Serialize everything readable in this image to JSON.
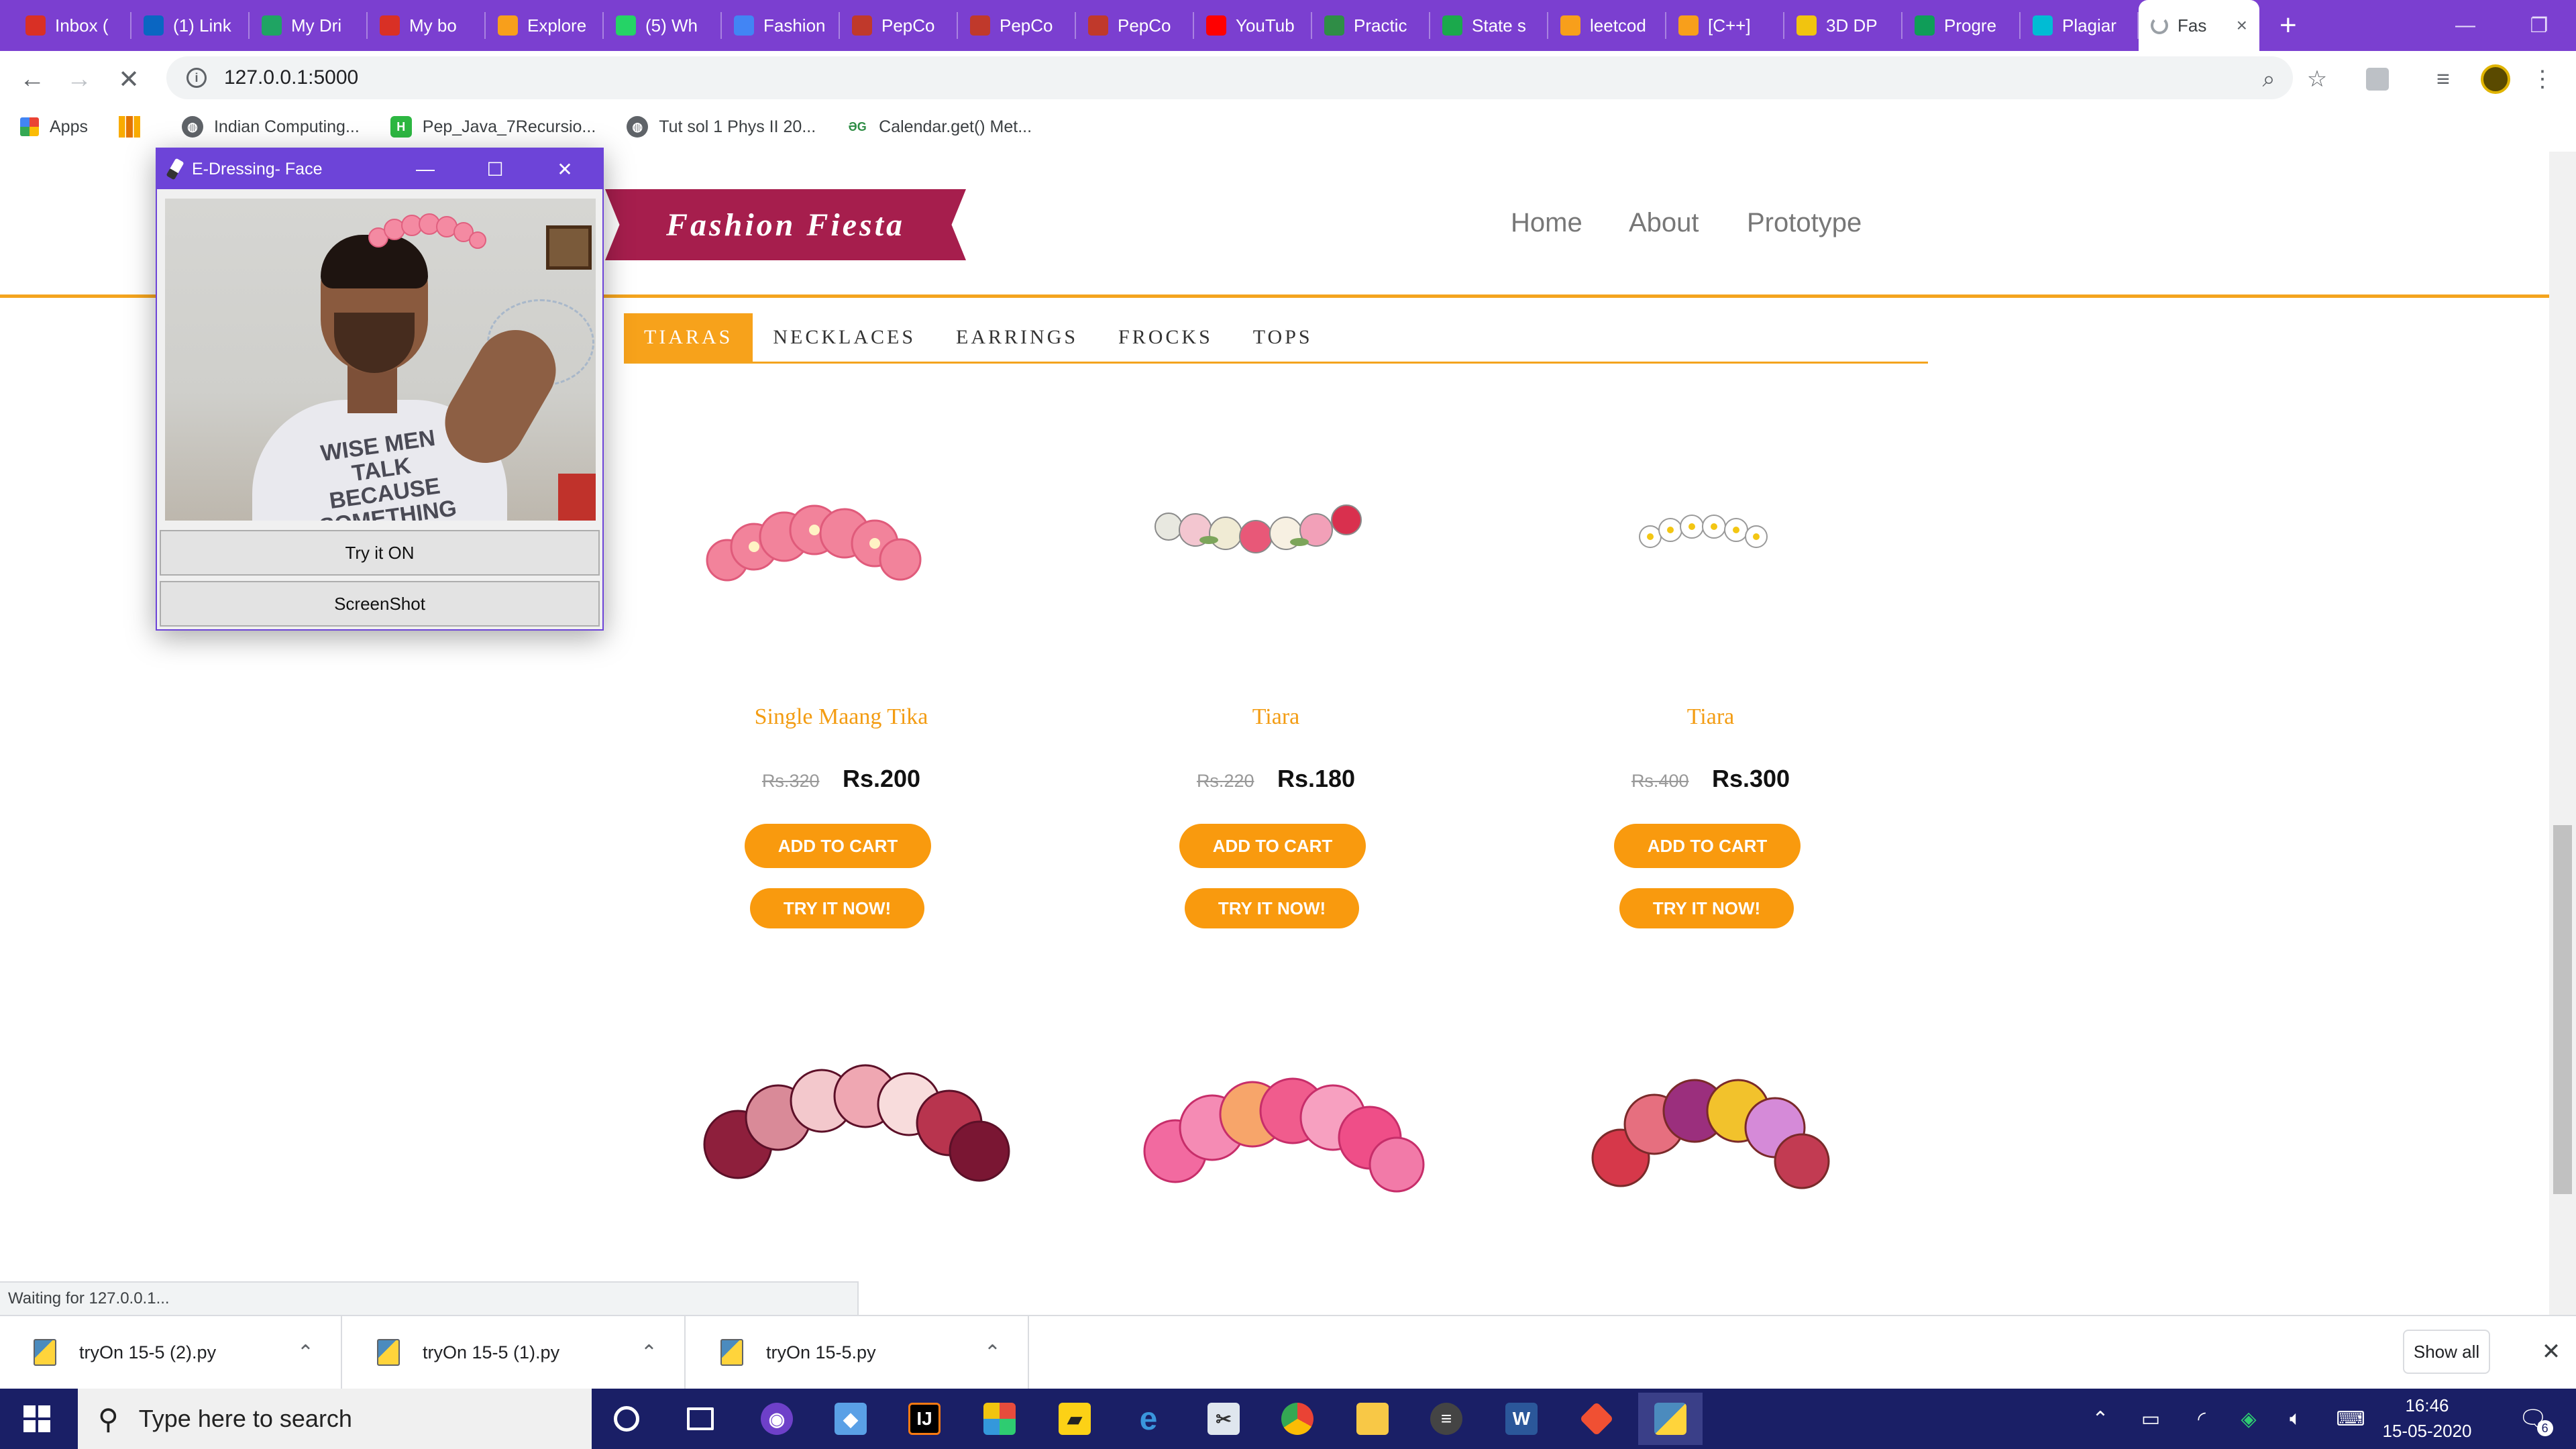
{
  "browser": {
    "tabs": [
      {
        "label": "Inbox (",
        "icon": "gmail-icon",
        "color": "#d93025"
      },
      {
        "label": "(1) Link",
        "icon": "linkedin-icon",
        "color": "#0a66c2"
      },
      {
        "label": "My Dri",
        "icon": "drive-icon",
        "color": "#1fa463"
      },
      {
        "label": "My bo",
        "icon": "gmail-icon",
        "color": "#d93025"
      },
      {
        "label": "Explore",
        "icon": "leetcode-icon",
        "color": "#f89f1b"
      },
      {
        "label": "(5) Wh",
        "icon": "whatsapp-icon",
        "color": "#25d366"
      },
      {
        "label": "Fashion",
        "icon": "docs-icon",
        "color": "#4285f4"
      },
      {
        "label": "PepCo",
        "icon": "pepcoding-icon",
        "color": "#c0392b"
      },
      {
        "label": "PepCo",
        "icon": "pepcoding-icon",
        "color": "#c0392b"
      },
      {
        "label": "PepCo",
        "icon": "pepcoding-icon",
        "color": "#c0392b"
      },
      {
        "label": "YouTub",
        "icon": "youtube-icon",
        "color": "#ff0000"
      },
      {
        "label": "Practic",
        "icon": "gfg-icon",
        "color": "#2f8d46"
      },
      {
        "label": "State s",
        "icon": "hackerrank-icon",
        "color": "#1ba94c"
      },
      {
        "label": "leetcod",
        "icon": "leetcode-icon",
        "color": "#f89f1b"
      },
      {
        "label": "[C++] ",
        "icon": "leetcode-icon",
        "color": "#f89f1b"
      },
      {
        "label": "3D DP",
        "icon": "bulb-icon",
        "color": "#f1c40f"
      },
      {
        "label": "Progre",
        "icon": "classroom-icon",
        "color": "#0f9d58"
      },
      {
        "label": "Plagiar",
        "icon": "plagiarism-icon",
        "color": "#00bcd4"
      }
    ],
    "active_tab": {
      "label": "Fas"
    },
    "url": "127.0.0.1:5000",
    "bookmarks": [
      {
        "label": "Apps"
      },
      {
        "label": ""
      },
      {
        "label": "Indian Computing..."
      },
      {
        "label": "Pep_Java_7Recursio..."
      },
      {
        "label": "Tut sol 1 Phys II 20..."
      },
      {
        "label": "Calendar.get() Met..."
      }
    ],
    "status_text": "Waiting for 127.0.0.1..."
  },
  "site": {
    "brand": "Fashion Fiesta",
    "nav": {
      "home": "Home",
      "about": "About",
      "prototype": "Prototype"
    },
    "categories": [
      "TIARAS",
      "NECKLACES",
      "EARRINGS",
      "FROCKS",
      "TOPS"
    ],
    "active_category": "TIARAS",
    "products": [
      {
        "name": "Single Maang Tika",
        "old_price": "Rs.320",
        "price": "Rs.200",
        "cart": "ADD TO CART",
        "try": "TRY IT NOW!"
      },
      {
        "name": "Tiara",
        "old_price": "Rs.220",
        "price": "Rs.180",
        "cart": "ADD TO CART",
        "try": "TRY IT NOW!"
      },
      {
        "name": "Tiara",
        "old_price": "Rs.400",
        "price": "Rs.300",
        "cart": "ADD TO CART",
        "try": "TRY IT NOW!"
      }
    ]
  },
  "face_window": {
    "title": "E-Dressing- Face",
    "try_button": "Try it ON",
    "screenshot_button": "ScreenShot",
    "shirt_text": "WISE MEN TALK BECAUSE SOMETHING"
  },
  "downloads": {
    "items": [
      {
        "name": "tryOn 15-5 (2).py"
      },
      {
        "name": "tryOn 15-5 (1).py"
      },
      {
        "name": "tryOn 15-5.py"
      }
    ],
    "show_all": "Show all"
  },
  "taskbar": {
    "search_placeholder": "Type here to search",
    "time": "16:46",
    "date": "15-05-2020",
    "notifications": "6"
  },
  "colors": {
    "chrome_purple": "#7b3fd0",
    "accent_orange": "#f99a0e",
    "brand_ribbon": "#a61e4d",
    "taskbar": "#1a1f66"
  }
}
